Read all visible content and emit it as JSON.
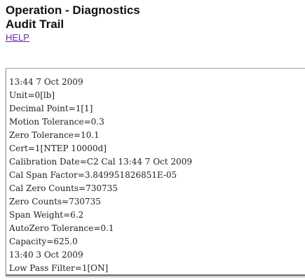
{
  "header": {
    "title_line1": "Operation - Diagnostics",
    "title_line2": "Audit Trail",
    "help_label": "HELP"
  },
  "log": {
    "lines": [
      "13:44 7 Oct 2009",
      "Unit=0[lb]",
      "Decimal Point=1[1]",
      "Motion Tolerance=0.3",
      "Zero Tolerance=10.1",
      "Cert=1[NTEP 10000d]",
      "Calibration Date=C2 Cal 13:44 7 Oct 2009",
      "Cal Span Factor=3.849951826851E-05",
      "Cal Zero Counts=730735",
      "Zero Counts=730735",
      "Span Weight=6.2",
      "AutoZero Tolerance=0.1",
      "Capacity=625.0",
      "13:40 3 Oct 2009",
      "Low Pass Filter=1[ON]"
    ]
  }
}
